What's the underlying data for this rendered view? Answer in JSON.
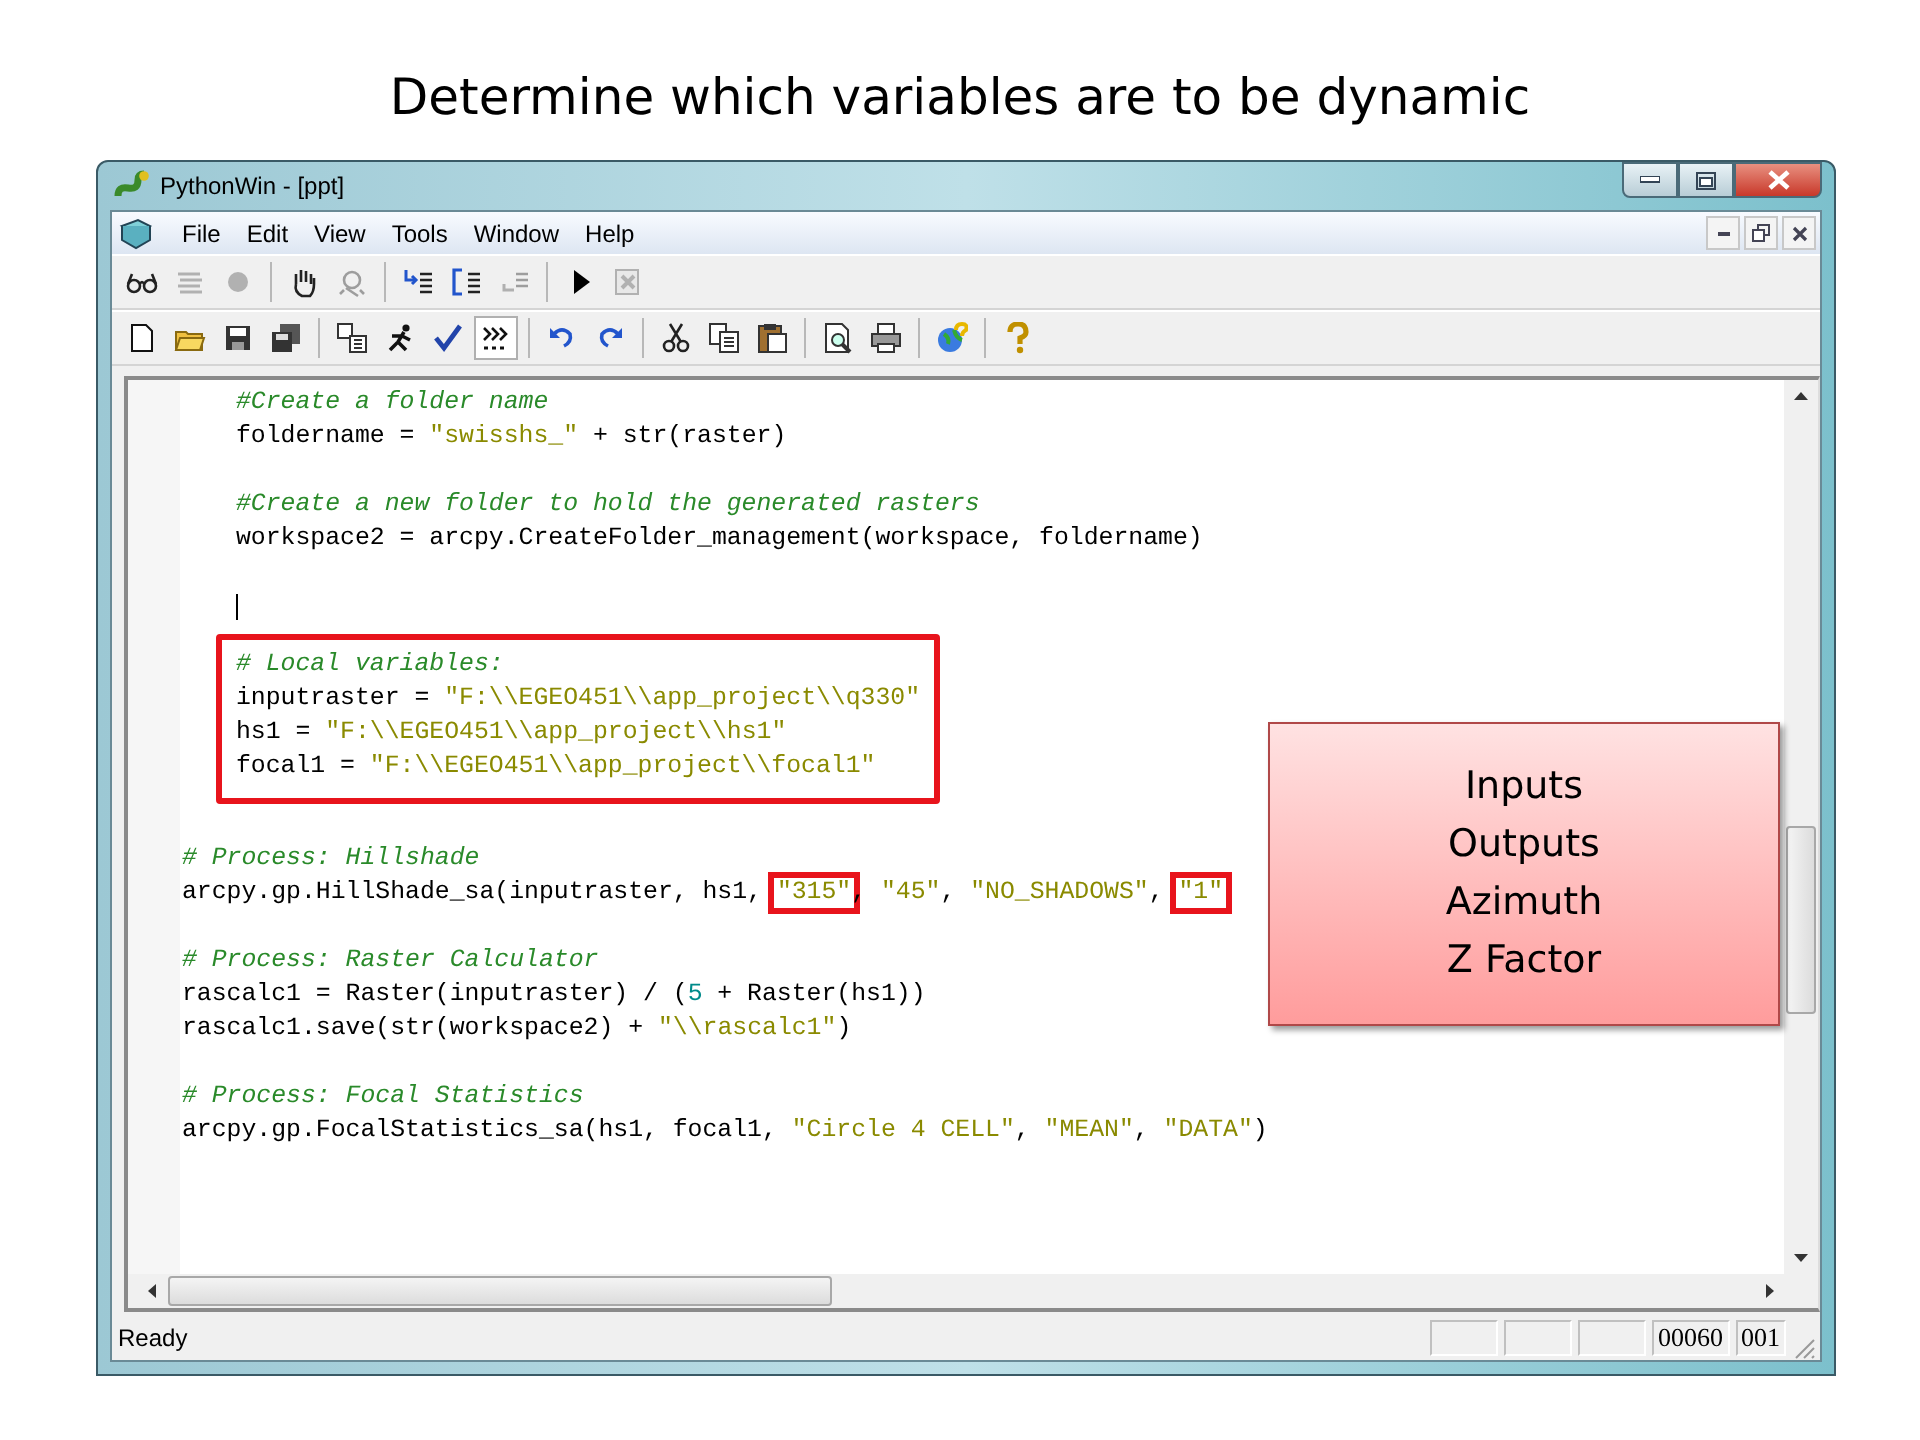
{
  "slide": {
    "title": "Determine which variables are to be dynamic"
  },
  "window": {
    "title": "PythonWin - [ppt]"
  },
  "menu": [
    "File",
    "Edit",
    "View",
    "Tools",
    "Window",
    "Help"
  ],
  "toolbars": [
    [
      {
        "kind": "button",
        "disabled": false,
        "pressed": false
      },
      {
        "kind": "button",
        "disabled": true,
        "pressed": false
      },
      {
        "kind": "button",
        "disabled": true,
        "pressed": false
      },
      {
        "kind": "separator"
      },
      {
        "kind": "button",
        "disabled": false,
        "pressed": false
      },
      {
        "kind": "button",
        "disabled": true,
        "pressed": false
      },
      {
        "kind": "separator"
      },
      {
        "kind": "button",
        "disabled": false,
        "pressed": false
      },
      {
        "kind": "button",
        "disabled": false,
        "pressed": false
      },
      {
        "kind": "button",
        "disabled": true,
        "pressed": false
      },
      {
        "kind": "separator"
      },
      {
        "kind": "button",
        "disabled": false,
        "pressed": false
      },
      {
        "kind": "button",
        "disabled": true,
        "pressed": false
      }
    ],
    [
      {
        "kind": "button",
        "disabled": false,
        "pressed": false
      },
      {
        "kind": "button",
        "disabled": false,
        "pressed": false
      },
      {
        "kind": "button",
        "disabled": false,
        "pressed": false
      },
      {
        "kind": "button",
        "disabled": false,
        "pressed": false
      },
      {
        "kind": "separator"
      },
      {
        "kind": "button",
        "disabled": false,
        "pressed": false
      },
      {
        "kind": "button",
        "disabled": false,
        "pressed": false
      },
      {
        "kind": "button",
        "disabled": false,
        "pressed": false
      },
      {
        "kind": "button",
        "disabled": false,
        "pressed": true
      },
      {
        "kind": "separator"
      },
      {
        "kind": "button",
        "disabled": false,
        "pressed": false
      },
      {
        "kind": "button",
        "disabled": false,
        "pressed": false
      },
      {
        "kind": "separator"
      },
      {
        "kind": "button",
        "disabled": false,
        "pressed": false
      },
      {
        "kind": "button",
        "disabled": false,
        "pressed": false
      },
      {
        "kind": "button",
        "disabled": false,
        "pressed": false
      },
      {
        "kind": "separator"
      },
      {
        "kind": "button",
        "disabled": false,
        "pressed": false
      },
      {
        "kind": "button",
        "disabled": false,
        "pressed": false
      },
      {
        "kind": "separator"
      },
      {
        "kind": "button",
        "disabled": false,
        "pressed": false
      },
      {
        "kind": "separator"
      },
      {
        "kind": "button",
        "disabled": false,
        "pressed": false
      }
    ]
  ],
  "editor": {
    "blocks": [
      {
        "indented": true,
        "highlighted": false,
        "lines": [
          {
            "kind": "code",
            "tokens": [
              {
                "kind": "comment",
                "text": "#Create a folder name",
                "highlighted": false
              }
            ]
          },
          {
            "kind": "code",
            "tokens": [
              {
                "kind": "plain",
                "text": "foldername = ",
                "highlighted": false
              },
              {
                "kind": "string",
                "text": "\"swisshs_\"",
                "highlighted": false
              },
              {
                "kind": "plain",
                "text": " + str(raster)",
                "highlighted": false
              }
            ]
          },
          {
            "kind": "blank"
          },
          {
            "kind": "code",
            "tokens": [
              {
                "kind": "comment",
                "text": "#Create a new folder to hold the generated rasters",
                "highlighted": false
              }
            ]
          },
          {
            "kind": "code",
            "tokens": [
              {
                "kind": "plain",
                "text": "workspace2 = arcpy.CreateFolder_management(workspace, foldername)",
                "highlighted": false
              }
            ]
          },
          {
            "kind": "blank"
          },
          {
            "kind": "cursor"
          }
        ]
      },
      {
        "indented": true,
        "highlighted": true,
        "lines": [
          {
            "kind": "code",
            "tokens": [
              {
                "kind": "comment",
                "text": "# Local variables:",
                "highlighted": false
              }
            ]
          },
          {
            "kind": "code",
            "tokens": [
              {
                "kind": "plain",
                "text": "inputraster = ",
                "highlighted": false
              },
              {
                "kind": "string",
                "text": "\"F:\\\\EGEO451\\\\app_project\\\\q330\"",
                "highlighted": false
              }
            ]
          },
          {
            "kind": "code",
            "tokens": [
              {
                "kind": "plain",
                "text": "hs1 = ",
                "highlighted": false
              },
              {
                "kind": "string",
                "text": "\"F:\\\\EGEO451\\\\app_project\\\\hs1\"",
                "highlighted": false
              }
            ]
          },
          {
            "kind": "code",
            "tokens": [
              {
                "kind": "plain",
                "text": "focal1 = ",
                "highlighted": false
              },
              {
                "kind": "string",
                "text": "\"F:\\\\EGEO451\\\\app_project\\\\focal1\"",
                "highlighted": false
              }
            ]
          }
        ]
      },
      {
        "indented": false,
        "highlighted": false,
        "lines": [
          {
            "kind": "blank"
          },
          {
            "kind": "code",
            "tokens": [
              {
                "kind": "comment",
                "text": "# Process: Hillshade",
                "highlighted": false
              }
            ]
          },
          {
            "kind": "code",
            "tokens": [
              {
                "kind": "plain",
                "text": "arcpy.gp.HillShade_sa(inputraster, hs1, ",
                "highlighted": false
              },
              {
                "kind": "string",
                "text": "\"315\"",
                "highlighted": true
              },
              {
                "kind": "plain",
                "text": ", ",
                "highlighted": false
              },
              {
                "kind": "string",
                "text": "\"45\"",
                "highlighted": false
              },
              {
                "kind": "plain",
                "text": ", ",
                "highlighted": false
              },
              {
                "kind": "string",
                "text": "\"NO_SHADOWS\"",
                "highlighted": false
              },
              {
                "kind": "plain",
                "text": ", ",
                "highlighted": false
              },
              {
                "kind": "string",
                "text": "\"1\"",
                "highlighted": true
              }
            ]
          },
          {
            "kind": "blank"
          },
          {
            "kind": "code",
            "tokens": [
              {
                "kind": "comment",
                "text": "# Process: Raster Calculator",
                "highlighted": false
              }
            ]
          },
          {
            "kind": "code",
            "tokens": [
              {
                "kind": "plain",
                "text": "rascalc1 = Raster(inputraster) / (",
                "highlighted": false
              },
              {
                "kind": "number",
                "text": "5",
                "highlighted": false
              },
              {
                "kind": "plain",
                "text": " + Raster(hs1))",
                "highlighted": false
              }
            ]
          },
          {
            "kind": "code",
            "tokens": [
              {
                "kind": "plain",
                "text": "rascalc1.save(str(workspace2) + ",
                "highlighted": false
              },
              {
                "kind": "string",
                "text": "\"\\\\rascalc1\"",
                "highlighted": false
              },
              {
                "kind": "plain",
                "text": ")",
                "highlighted": false
              }
            ]
          },
          {
            "kind": "blank"
          },
          {
            "kind": "code",
            "tokens": [
              {
                "kind": "comment",
                "text": "# Process: Focal Statistics",
                "highlighted": false
              }
            ]
          },
          {
            "kind": "code",
            "tokens": [
              {
                "kind": "plain",
                "text": "arcpy.gp.FocalStatistics_sa(hs1, focal1, ",
                "highlighted": false
              },
              {
                "kind": "string",
                "text": "\"Circle 4 CELL\"",
                "highlighted": false
              },
              {
                "kind": "plain",
                "text": ", ",
                "highlighted": false
              },
              {
                "kind": "string",
                "text": "\"MEAN\"",
                "highlighted": false
              },
              {
                "kind": "plain",
                "text": ", ",
                "highlighted": false
              },
              {
                "kind": "string",
                "text": "\"DATA\"",
                "highlighted": false
              },
              {
                "kind": "plain",
                "text": ")",
                "highlighted": false
              }
            ]
          }
        ]
      }
    ]
  },
  "status_bar": {
    "message": "Ready",
    "panes": [
      "00060",
      "001"
    ]
  },
  "callout": {
    "lines": [
      "Inputs",
      "Outputs",
      "Azimuth",
      "Z Factor"
    ]
  }
}
